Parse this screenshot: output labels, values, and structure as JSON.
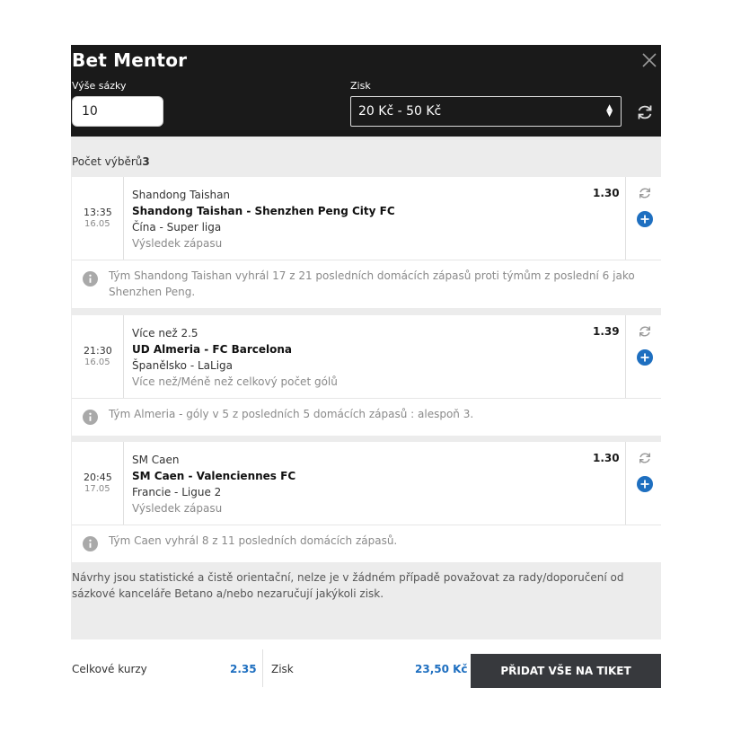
{
  "header": {
    "title": "Bet Mentor",
    "stake_label": "Výše sázky",
    "stake_value": "10",
    "profit_label": "Zisk",
    "profit_range": "20 Kč - 50 Kč"
  },
  "selection_count": {
    "label": "Počet výběrů",
    "value": "3"
  },
  "bets": [
    {
      "time": "13:35",
      "date": "16.05",
      "selection": "Shandong Taishan",
      "event": "Shandong Taishan - Shenzhen Peng City FC",
      "league": "Čína - Super liga",
      "market": "Výsledek zápasu",
      "odds": "1.30",
      "tip": "Tým Shandong Taishan vyhrál 17 z 21 posledních domácích zápasů proti týmům z poslední 6 jako Shenzhen Peng."
    },
    {
      "time": "21:30",
      "date": "16.05",
      "selection": "Více než 2.5",
      "event": "UD Almeria - FC Barcelona",
      "league": "Španělsko - LaLiga",
      "market": "Více než/Méně než celkový počet gólů",
      "odds": "1.39",
      "tip": "Tým Almeria - góly v 5 z posledních 5 domácích zápasů : alespoň 3."
    },
    {
      "time": "20:45",
      "date": "17.05",
      "selection": "SM Caen",
      "event": "SM Caen - Valenciennes FC",
      "league": "Francie - Ligue 2",
      "market": "Výsledek zápasu",
      "odds": "1.30",
      "tip": "Tým Caen vyhrál 8 z 11 posledních domácích zápasů."
    }
  ],
  "disclaimer": "Návrhy jsou statistické a čistě orientační, nelze je v žádném případě považovat za rady/doporučení od sázkové kanceláře Betano a/nebo nezaručují jakýkoli zisk.",
  "footer": {
    "total_odds_label": "Celkové kurzy",
    "total_odds_value": "2.35",
    "profit_label": "Zisk",
    "profit_value": "23,50 Kč",
    "add_all_label": "PŘIDAT VŠE NA TIKET"
  },
  "colors": {
    "header_bg": "#1a1a1a",
    "accent_blue": "#1e6fc0",
    "button_bg": "#37393d"
  }
}
